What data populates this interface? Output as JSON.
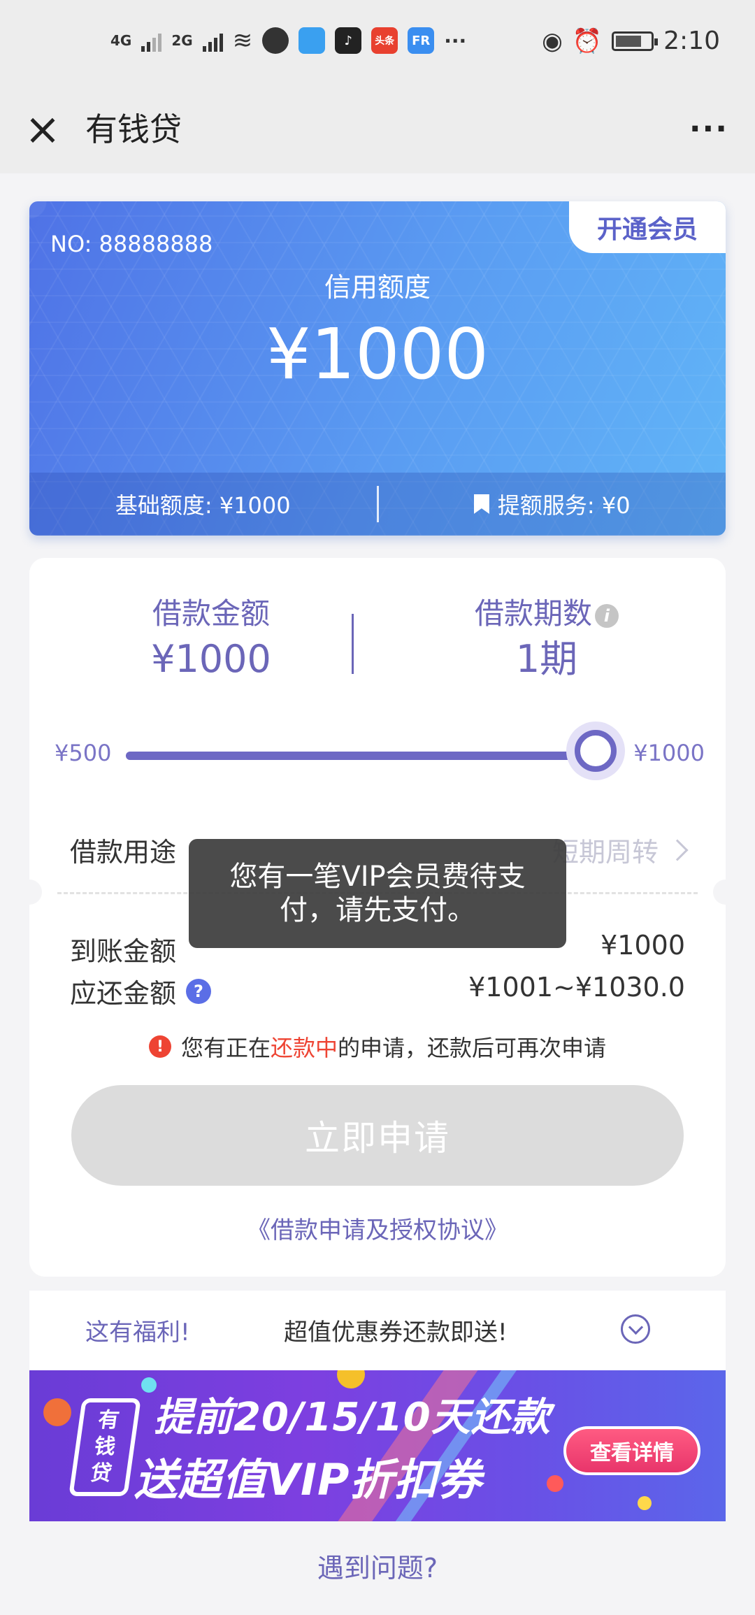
{
  "status_bar": {
    "net1": "4G",
    "net2": "2G",
    "time": "2:10",
    "apps": [
      {
        "icon": "message-bubble-icon",
        "text": "",
        "color": "#333333"
      },
      {
        "icon": "app-icon-blue",
        "text": "",
        "color": "#3aa0f0"
      },
      {
        "icon": "tiktok-icon",
        "text": "♪",
        "color": "#222222"
      },
      {
        "icon": "toutiao-icon",
        "text": "头条",
        "color": "#e8402f"
      },
      {
        "icon": "app-icon-fr",
        "text": "FR",
        "color": "#3a8ef0"
      }
    ],
    "more": "···"
  },
  "nav": {
    "close_icon": "×",
    "title": "有钱贷",
    "more_icon": "···"
  },
  "credit_card": {
    "no": "NO: 88888888",
    "vip_label": "开通会员",
    "credit_label": "信用额度",
    "credit_amount": "¥1000",
    "base_quota": "基础额度: ¥1000",
    "raise_service": "提额服务: ¥0"
  },
  "loan": {
    "amount_label": "借款金额",
    "amount_value": "¥1000",
    "term_label": "借款期数",
    "term_info_icon": "i",
    "term_value": "1期",
    "slider_min": "¥500",
    "slider_max": "¥1000",
    "slider_fraction": 1.0,
    "purpose_label": "借款用途",
    "purpose_value": "短期周转",
    "arrival_label": "到账金额",
    "arrival_value": "¥1000",
    "repay_label": "应还金额",
    "repay_help_icon": "?",
    "repay_value": "¥1001~¥1030.0",
    "notice_icon": "!",
    "notice_prefix": "您有正在",
    "notice_highlight": "还款中",
    "notice_suffix": "的申请，还款后可再次申请",
    "apply_button": "立即申请",
    "agreement": "《借款申请及授权协议》"
  },
  "toast": {
    "message": "您有一笔VIP会员费待支付，请先支付。"
  },
  "benefit": {
    "label": "这有福利!",
    "text": "超值优惠券还款即送!"
  },
  "banner": {
    "logo_text_1": "有",
    "logo_text_2": "钱",
    "logo_text_3": "贷",
    "line1": "提前20/15/10天还款",
    "line2": "送超值VIP折扣券",
    "detail_button": "查看详情"
  },
  "help": {
    "text": "遇到问题?"
  },
  "colors": {
    "accent": "#6b66b8",
    "card_start": "#4f72e6",
    "card_end": "#61b5f7",
    "warn": "#ee4433"
  }
}
